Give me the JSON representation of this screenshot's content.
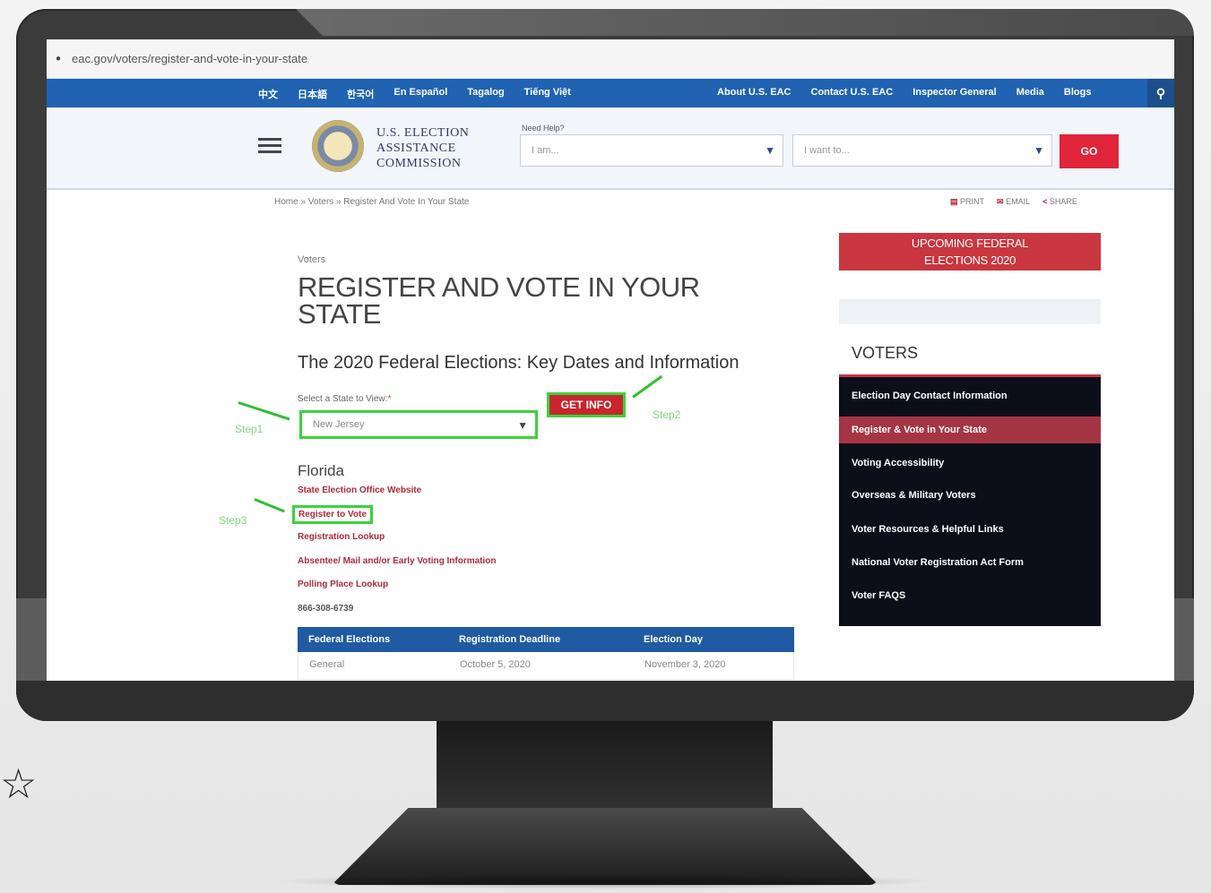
{
  "browser": {
    "url": "eac.gov/voters/register-and-vote-in-your-state"
  },
  "topnav": {
    "languages": [
      "中文",
      "日本語",
      "한국어",
      "En Español",
      "Tagalog",
      "Tiếng Việt"
    ],
    "links": [
      "About U.S. EAC",
      "Contact U.S. EAC",
      "Inspector General",
      "Media",
      "Blogs"
    ]
  },
  "header": {
    "logo_lines": [
      "U.S. ELECTION",
      "ASSISTANCE",
      "COMMISSION"
    ],
    "need_help": "Need Help?",
    "select1_placeholder": "I am...",
    "select2_placeholder": "I want to...",
    "go_label": "GO"
  },
  "breadcrumb": {
    "text": "Home  » Voters  » Register And Vote In Your State"
  },
  "tools": {
    "print": "PRINT",
    "email": "EMAIL",
    "share": "SHARE"
  },
  "main": {
    "eyebrow": "Voters",
    "title": "REGISTER AND VOTE IN YOUR STATE",
    "subtitle": "The 2020 Federal Elections: Key Dates and Information",
    "state_label": "Select a State to View:",
    "state_value": "New Jersey",
    "get_info": "GET INFO",
    "steps": {
      "step1": "Step1",
      "step2": "Step2",
      "step3": "Step3"
    },
    "state_name": "Florida",
    "links": [
      "State Election Office Website",
      "Register to Vote",
      "Registration Lookup",
      "Absentee/ Mail and/or Early Voting Information",
      "Polling Place Lookup"
    ],
    "phone": "866-308-6739",
    "table": {
      "headers": [
        "Federal Elections",
        "Registration Deadline",
        "Election Day"
      ],
      "rows": [
        [
          "General",
          "October 5, 2020",
          "November 3, 2020"
        ]
      ]
    }
  },
  "sidebar": {
    "upcoming": [
      "UPCOMING FEDERAL",
      "ELECTIONS 2020"
    ],
    "voters_heading": "VOTERS",
    "menu": [
      "Election Day Contact Information",
      "Register & Vote in Your State",
      "Voting Accessibility",
      "Overseas & Military Voters",
      "Voter Resources & Helpful Links",
      "National Voter Registration Act Form",
      "Voter FAQS"
    ],
    "active_index": 1
  },
  "colors": {
    "nav_blue": "#1f63b2",
    "accent_red": "#c9252f",
    "annotation_green": "#3bd33b"
  }
}
